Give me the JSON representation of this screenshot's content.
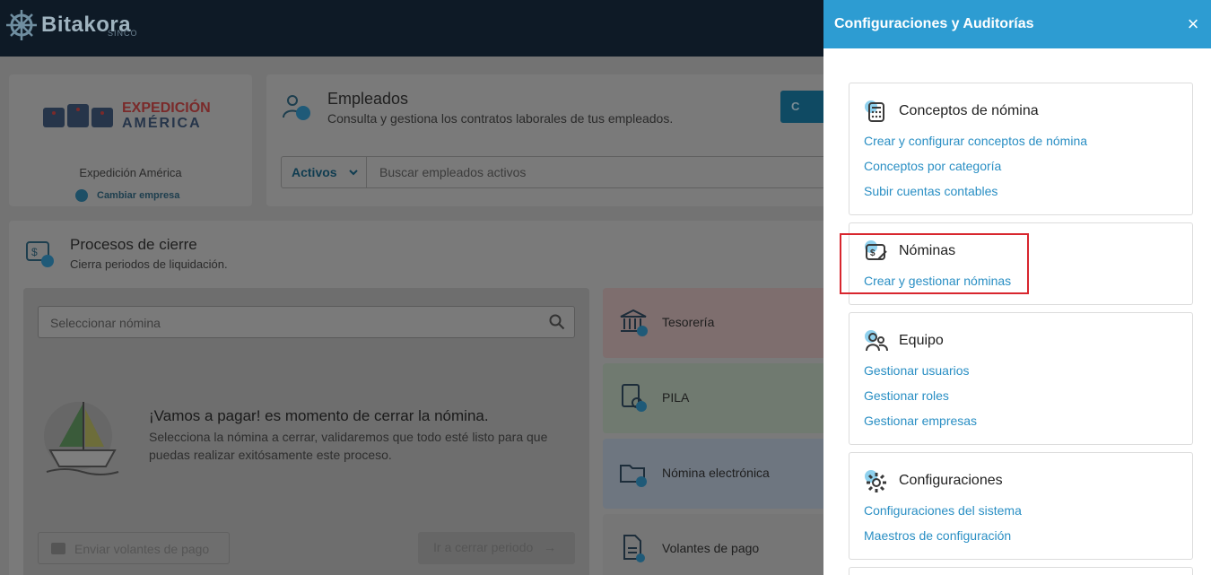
{
  "app": {
    "brand_name": "Bitakora",
    "brand_sub": "SINCO"
  },
  "company": {
    "logo_line1": "EXPEDICIÓN",
    "logo_line2": "AMÉRICA",
    "name": "Expedición América",
    "change_label": "Cambiar empresa"
  },
  "employees": {
    "title": "Empleados",
    "subtitle": "Consulta y gestiona los contratos laborales de tus empleados.",
    "button_label": "C",
    "filter_value": "Activos",
    "search_placeholder": "Buscar empleados activos"
  },
  "closing": {
    "title": "Procesos de cierre",
    "subtitle": "Cierra periodos de liquidación.",
    "search_placeholder": "Seleccionar nómina",
    "headline": "¡Vamos a pagar! es momento de cerrar la nómina.",
    "description": "Selecciona la nómina a cerrar, validaremos que todo esté listo para que puedas realizar exitósamente este proceso.",
    "send_button": "Enviar volantes de pago",
    "close_button": "Ir a cerrar periodo",
    "tiles": [
      {
        "label": "Tesorería"
      },
      {
        "label": "PILA"
      },
      {
        "label": "Nómina electrónica"
      },
      {
        "label": "Volantes de pago"
      }
    ]
  },
  "panel": {
    "title": "Configuraciones y Auditorías",
    "close_icon": "×",
    "sections": [
      {
        "title": "Conceptos de nómina",
        "icon": "calculator-icon",
        "links": [
          "Crear y configurar conceptos de nómina",
          "Conceptos por categoría",
          "Subir cuentas contables"
        ]
      },
      {
        "title": "Nóminas",
        "icon": "payroll-icon",
        "links": [
          "Crear y gestionar nóminas"
        ]
      },
      {
        "title": "Equipo",
        "icon": "team-icon",
        "links": [
          "Gestionar usuarios",
          "Gestionar roles",
          "Gestionar empresas"
        ]
      },
      {
        "title": "Configuraciones",
        "icon": "gear-icon",
        "links": [
          "Configuraciones del sistema",
          "Maestros de configuración"
        ]
      }
    ]
  },
  "colors": {
    "accent": "#2d9cd2",
    "link": "#2a8fc4",
    "highlight": "#d8262e",
    "topbar": "#0e1a26"
  }
}
